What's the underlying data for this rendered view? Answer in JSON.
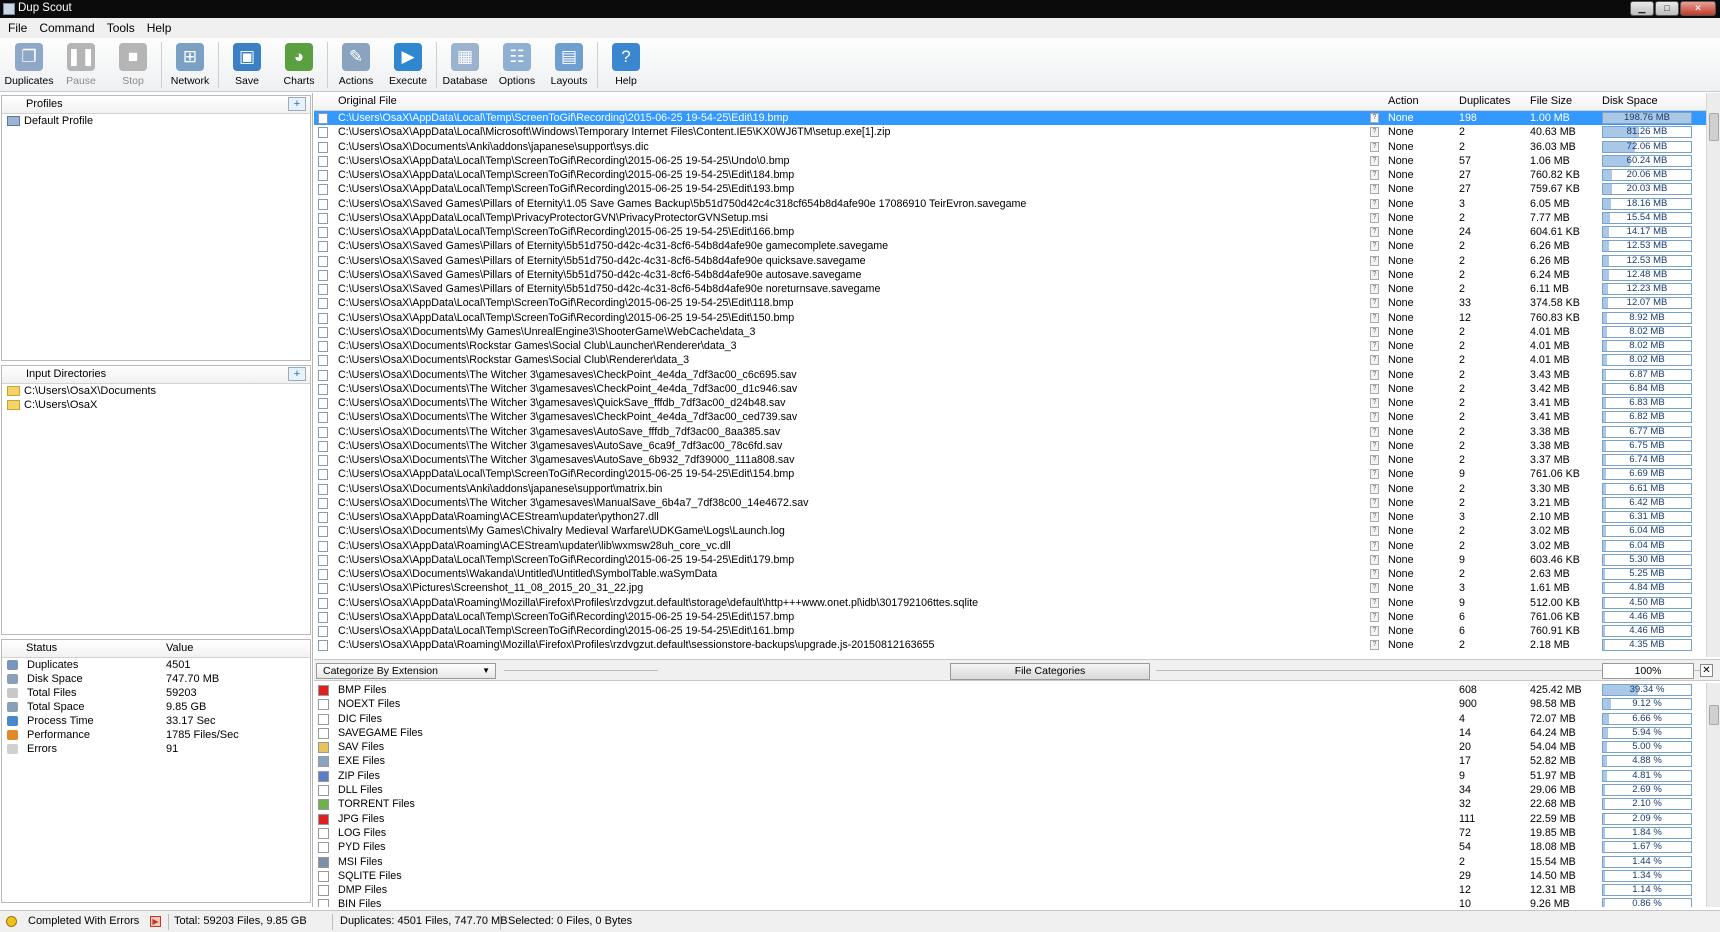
{
  "window": {
    "title": "Dup Scout"
  },
  "menu": [
    "File",
    "Command",
    "Tools",
    "Help"
  ],
  "toolbar": [
    {
      "label": "Duplicates",
      "icon": "duplicates-icon",
      "color": "#8fa8c8",
      "glyph": "❐",
      "enabled": true
    },
    {
      "label": "Pause",
      "icon": "pause-icon",
      "color": "#b5b5b5",
      "glyph": "❚❚",
      "enabled": false
    },
    {
      "label": "Stop",
      "icon": "stop-icon",
      "color": "#b5b5b5",
      "glyph": "■",
      "enabled": false
    },
    {
      "label": "Network",
      "icon": "network-icon",
      "color": "#7aa0c4",
      "glyph": "⊞",
      "enabled": true
    },
    {
      "label": "Save",
      "icon": "save-icon",
      "color": "#3b7fc4",
      "glyph": "▣",
      "enabled": true
    },
    {
      "label": "Charts",
      "icon": "charts-icon",
      "color": "#5aa040",
      "glyph": "◕",
      "enabled": true
    },
    {
      "label": "Actions",
      "icon": "actions-icon",
      "color": "#8aa4c0",
      "glyph": "✎",
      "enabled": true
    },
    {
      "label": "Execute",
      "icon": "execute-icon",
      "color": "#2f87d0",
      "glyph": "▶",
      "enabled": true
    },
    {
      "label": "Database",
      "icon": "database-icon",
      "color": "#9bb3cf",
      "glyph": "▦",
      "enabled": true
    },
    {
      "label": "Options",
      "icon": "options-icon",
      "color": "#8fb0d0",
      "glyph": "☷",
      "enabled": true
    },
    {
      "label": "Layouts",
      "icon": "layouts-icon",
      "color": "#6f9fce",
      "glyph": "▤",
      "enabled": true
    },
    {
      "label": "Help",
      "icon": "help-icon",
      "color": "#3a86cf",
      "glyph": "?",
      "enabled": true
    }
  ],
  "profiles": {
    "title": "Profiles",
    "items": [
      "Default Profile"
    ]
  },
  "input_dirs": {
    "title": "Input Directories",
    "items": [
      "C:\\Users\\OsaX\\Documents",
      "C:\\Users\\OsaX"
    ]
  },
  "status": {
    "headers": [
      "Status",
      "Value"
    ],
    "rows": [
      {
        "k": "Duplicates",
        "v": "4501",
        "color": "#7a96bd"
      },
      {
        "k": "Disk Space",
        "v": "747.70 MB",
        "color": "#8aa0b8"
      },
      {
        "k": "Total Files",
        "v": "59203",
        "color": "#c8c8c8"
      },
      {
        "k": "Total Space",
        "v": "9.85 GB",
        "color": "#8aa0b8"
      },
      {
        "k": "Process Time",
        "v": "33.17 Sec",
        "color": "#4a88c8"
      },
      {
        "k": "Performance",
        "v": "1785 Files/Sec",
        "color": "#e08a2a"
      },
      {
        "k": "Errors",
        "v": "91",
        "color": "#d0d0d0"
      }
    ]
  },
  "files": {
    "headers": [
      "Original File",
      "Action",
      "Duplicates",
      "File Size",
      "Disk Space"
    ],
    "max_disk": 198.76,
    "rows": [
      [
        "C:\\Users\\OsaX\\AppData\\Local\\Temp\\ScreenToGif\\Recording\\2015-06-25 19-54-25\\Edit\\19.bmp",
        "None",
        "198",
        "1.00 MB",
        "198.76 MB",
        198.76
      ],
      [
        "C:\\Users\\OsaX\\AppData\\Local\\Microsoft\\Windows\\Temporary Internet Files\\Content.IE5\\KX0WJ6TM\\setup.exe[1].zip",
        "None",
        "2",
        "40.63 MB",
        "81.26 MB",
        81.26
      ],
      [
        "C:\\Users\\OsaX\\Documents\\Anki\\addons\\japanese\\support\\sys.dic",
        "None",
        "2",
        "36.03 MB",
        "72.06 MB",
        72.06
      ],
      [
        "C:\\Users\\OsaX\\AppData\\Local\\Temp\\ScreenToGif\\Recording\\2015-06-25 19-54-25\\Undo\\0.bmp",
        "None",
        "57",
        "1.06 MB",
        "60.24 MB",
        60.24
      ],
      [
        "C:\\Users\\OsaX\\AppData\\Local\\Temp\\ScreenToGif\\Recording\\2015-06-25 19-54-25\\Edit\\184.bmp",
        "None",
        "27",
        "760.82 KB",
        "20.06 MB",
        20.06
      ],
      [
        "C:\\Users\\OsaX\\AppData\\Local\\Temp\\ScreenToGif\\Recording\\2015-06-25 19-54-25\\Edit\\193.bmp",
        "None",
        "27",
        "759.67 KB",
        "20.03 MB",
        20.03
      ],
      [
        "C:\\Users\\OsaX\\Saved Games\\Pillars of Eternity\\1.05 Save Games Backup\\5b51d750d42c4c318cf654b8d4afe90e 17086910 TeirEvron.savegame",
        "None",
        "3",
        "6.05 MB",
        "18.16 MB",
        18.16
      ],
      [
        "C:\\Users\\OsaX\\AppData\\Local\\Temp\\PrivacyProtectorGVN\\PrivacyProtectorGVNSetup.msi",
        "None",
        "2",
        "7.77 MB",
        "15.54 MB",
        15.54
      ],
      [
        "C:\\Users\\OsaX\\AppData\\Local\\Temp\\ScreenToGif\\Recording\\2015-06-25 19-54-25\\Edit\\166.bmp",
        "None",
        "24",
        "604.61 KB",
        "14.17 MB",
        14.17
      ],
      [
        "C:\\Users\\OsaX\\Saved Games\\Pillars of Eternity\\5b51d750-d42c-4c31-8cf6-54b8d4afe90e gamecomplete.savegame",
        "None",
        "2",
        "6.26 MB",
        "12.53 MB",
        12.53
      ],
      [
        "C:\\Users\\OsaX\\Saved Games\\Pillars of Eternity\\5b51d750-d42c-4c31-8cf6-54b8d4afe90e quicksave.savegame",
        "None",
        "2",
        "6.26 MB",
        "12.53 MB",
        12.53
      ],
      [
        "C:\\Users\\OsaX\\Saved Games\\Pillars of Eternity\\5b51d750-d42c-4c31-8cf6-54b8d4afe90e autosave.savegame",
        "None",
        "2",
        "6.24 MB",
        "12.48 MB",
        12.48
      ],
      [
        "C:\\Users\\OsaX\\Saved Games\\Pillars of Eternity\\5b51d750-d42c-4c31-8cf6-54b8d4afe90e noreturnsave.savegame",
        "None",
        "2",
        "6.11 MB",
        "12.23 MB",
        12.23
      ],
      [
        "C:\\Users\\OsaX\\AppData\\Local\\Temp\\ScreenToGif\\Recording\\2015-06-25 19-54-25\\Edit\\118.bmp",
        "None",
        "33",
        "374.58 KB",
        "12.07 MB",
        12.07
      ],
      [
        "C:\\Users\\OsaX\\AppData\\Local\\Temp\\ScreenToGif\\Recording\\2015-06-25 19-54-25\\Edit\\150.bmp",
        "None",
        "12",
        "760.83 KB",
        "8.92 MB",
        8.92
      ],
      [
        "C:\\Users\\OsaX\\Documents\\My Games\\UnrealEngine3\\ShooterGame\\WebCache\\data_3",
        "None",
        "2",
        "4.01 MB",
        "8.02 MB",
        8.02
      ],
      [
        "C:\\Users\\OsaX\\Documents\\Rockstar Games\\Social Club\\Launcher\\Renderer\\data_3",
        "None",
        "2",
        "4.01 MB",
        "8.02 MB",
        8.02
      ],
      [
        "C:\\Users\\OsaX\\Documents\\Rockstar Games\\Social Club\\Renderer\\data_3",
        "None",
        "2",
        "4.01 MB",
        "8.02 MB",
        8.02
      ],
      [
        "C:\\Users\\OsaX\\Documents\\The Witcher 3\\gamesaves\\CheckPoint_4e4da_7df3ac00_c6c695.sav",
        "None",
        "2",
        "3.43 MB",
        "6.87 MB",
        6.87
      ],
      [
        "C:\\Users\\OsaX\\Documents\\The Witcher 3\\gamesaves\\CheckPoint_4e4da_7df3ac00_d1c946.sav",
        "None",
        "2",
        "3.42 MB",
        "6.84 MB",
        6.84
      ],
      [
        "C:\\Users\\OsaX\\Documents\\The Witcher 3\\gamesaves\\QuickSave_fffdb_7df3ac00_d24b48.sav",
        "None",
        "2",
        "3.41 MB",
        "6.83 MB",
        6.83
      ],
      [
        "C:\\Users\\OsaX\\Documents\\The Witcher 3\\gamesaves\\CheckPoint_4e4da_7df3ac00_ced739.sav",
        "None",
        "2",
        "3.41 MB",
        "6.82 MB",
        6.82
      ],
      [
        "C:\\Users\\OsaX\\Documents\\The Witcher 3\\gamesaves\\AutoSave_fffdb_7df3ac00_8aa385.sav",
        "None",
        "2",
        "3.38 MB",
        "6.77 MB",
        6.77
      ],
      [
        "C:\\Users\\OsaX\\Documents\\The Witcher 3\\gamesaves\\AutoSave_6ca9f_7df3ac00_78c6fd.sav",
        "None",
        "2",
        "3.38 MB",
        "6.75 MB",
        6.75
      ],
      [
        "C:\\Users\\OsaX\\Documents\\The Witcher 3\\gamesaves\\AutoSave_6b932_7df39000_111a808.sav",
        "None",
        "2",
        "3.37 MB",
        "6.74 MB",
        6.74
      ],
      [
        "C:\\Users\\OsaX\\AppData\\Local\\Temp\\ScreenToGif\\Recording\\2015-06-25 19-54-25\\Edit\\154.bmp",
        "None",
        "9",
        "761.06 KB",
        "6.69 MB",
        6.69
      ],
      [
        "C:\\Users\\OsaX\\Documents\\Anki\\addons\\japanese\\support\\matrix.bin",
        "None",
        "2",
        "3.30 MB",
        "6.61 MB",
        6.61
      ],
      [
        "C:\\Users\\OsaX\\Documents\\The Witcher 3\\gamesaves\\ManualSave_6b4a7_7df38c00_14e4672.sav",
        "None",
        "2",
        "3.21 MB",
        "6.42 MB",
        6.42
      ],
      [
        "C:\\Users\\OsaX\\AppData\\Roaming\\ACEStream\\updater\\python27.dll",
        "None",
        "3",
        "2.10 MB",
        "6.31 MB",
        6.31
      ],
      [
        "C:\\Users\\OsaX\\Documents\\My Games\\Chivalry Medieval Warfare\\UDKGame\\Logs\\Launch.log",
        "None",
        "2",
        "3.02 MB",
        "6.04 MB",
        6.04
      ],
      [
        "C:\\Users\\OsaX\\AppData\\Roaming\\ACEStream\\updater\\lib\\wxmsw28uh_core_vc.dll",
        "None",
        "2",
        "3.02 MB",
        "6.04 MB",
        6.04
      ],
      [
        "C:\\Users\\OsaX\\AppData\\Local\\Temp\\ScreenToGif\\Recording\\2015-06-25 19-54-25\\Edit\\179.bmp",
        "None",
        "9",
        "603.46 KB",
        "5.30 MB",
        5.3
      ],
      [
        "C:\\Users\\OsaX\\Documents\\Wakanda\\Untitled\\Untitled\\SymbolTable.waSymData",
        "None",
        "2",
        "2.63 MB",
        "5.25 MB",
        5.25
      ],
      [
        "C:\\Users\\OsaX\\Pictures\\Screenshot_11_08_2015_20_31_22.jpg",
        "None",
        "3",
        "1.61 MB",
        "4.84 MB",
        4.84
      ],
      [
        "C:\\Users\\OsaX\\AppData\\Roaming\\Mozilla\\Firefox\\Profiles\\rzdvgzut.default\\storage\\default\\http+++www.onet.pl\\idb\\301792106ttes.sqlite",
        "None",
        "9",
        "512.00 KB",
        "4.50 MB",
        4.5
      ],
      [
        "C:\\Users\\OsaX\\AppData\\Local\\Temp\\ScreenToGif\\Recording\\2015-06-25 19-54-25\\Edit\\157.bmp",
        "None",
        "6",
        "761.06 KB",
        "4.46 MB",
        4.46
      ],
      [
        "C:\\Users\\OsaX\\AppData\\Local\\Temp\\ScreenToGif\\Recording\\2015-06-25 19-54-25\\Edit\\161.bmp",
        "None",
        "6",
        "760.91 KB",
        "4.46 MB",
        4.46
      ],
      [
        "C:\\Users\\OsaX\\AppData\\Roaming\\Mozilla\\Firefox\\Profiles\\rzdvgzut.default\\sessionstore-backups\\upgrade.js-20150812163655",
        "None",
        "2",
        "2.18 MB",
        "4.35 MB",
        4.35
      ]
    ]
  },
  "catbar": {
    "select": "Categorize By Extension",
    "button": "File Categories",
    "zoom": "100%"
  },
  "categories": [
    {
      "name": "BMP Files",
      "count": "608",
      "size": "425.42 MB",
      "pct": "39.34 %",
      "v": 39.34,
      "color": "#e02020"
    },
    {
      "name": "NOEXT Files",
      "count": "900",
      "size": "98.58 MB",
      "pct": "9.12 %",
      "v": 9.12,
      "color": "#ffffff"
    },
    {
      "name": "DIC Files",
      "count": "4",
      "size": "72.07 MB",
      "pct": "6.66 %",
      "v": 6.66,
      "color": "#ffffff"
    },
    {
      "name": "SAVEGAME Files",
      "count": "14",
      "size": "64.24 MB",
      "pct": "5.94 %",
      "v": 5.94,
      "color": "#ffffff"
    },
    {
      "name": "SAV Files",
      "count": "20",
      "size": "54.04 MB",
      "pct": "5.00 %",
      "v": 5.0,
      "color": "#e9c35a"
    },
    {
      "name": "EXE Files",
      "count": "17",
      "size": "52.82 MB",
      "pct": "4.88 %",
      "v": 4.88,
      "color": "#8aa4c0"
    },
    {
      "name": "ZIP Files",
      "count": "9",
      "size": "51.97 MB",
      "pct": "4.81 %",
      "v": 4.81,
      "color": "#5b7fc6"
    },
    {
      "name": "DLL Files",
      "count": "34",
      "size": "29.06 MB",
      "pct": "2.69 %",
      "v": 2.69,
      "color": "#ffffff"
    },
    {
      "name": "TORRENT Files",
      "count": "32",
      "size": "22.68 MB",
      "pct": "2.10 %",
      "v": 2.1,
      "color": "#6fb24c"
    },
    {
      "name": "JPG Files",
      "count": "111",
      "size": "22.59 MB",
      "pct": "2.09 %",
      "v": 2.09,
      "color": "#e02020"
    },
    {
      "name": "LOG Files",
      "count": "72",
      "size": "19.85 MB",
      "pct": "1.84 %",
      "v": 1.84,
      "color": "#ffffff"
    },
    {
      "name": "PYD Files",
      "count": "54",
      "size": "18.08 MB",
      "pct": "1.67 %",
      "v": 1.67,
      "color": "#ffffff"
    },
    {
      "name": "MSI Files",
      "count": "2",
      "size": "15.54 MB",
      "pct": "1.44 %",
      "v": 1.44,
      "color": "#7a90aa"
    },
    {
      "name": "SQLITE Files",
      "count": "29",
      "size": "14.50 MB",
      "pct": "1.34 %",
      "v": 1.34,
      "color": "#ffffff"
    },
    {
      "name": "DMP Files",
      "count": "12",
      "size": "12.31 MB",
      "pct": "1.14 %",
      "v": 1.14,
      "color": "#ffffff"
    },
    {
      "name": "BIN Files",
      "count": "10",
      "size": "9.26 MB",
      "pct": "0.86 %",
      "v": 0.86,
      "color": "#ffffff"
    }
  ],
  "statusbar": {
    "state": "Completed With Errors",
    "total": "Total: 59203 Files, 9.85 GB",
    "duplicates": "Duplicates: 4501 Files, 747.70 MB",
    "selected": "Selected: 0 Files, 0 Bytes"
  }
}
